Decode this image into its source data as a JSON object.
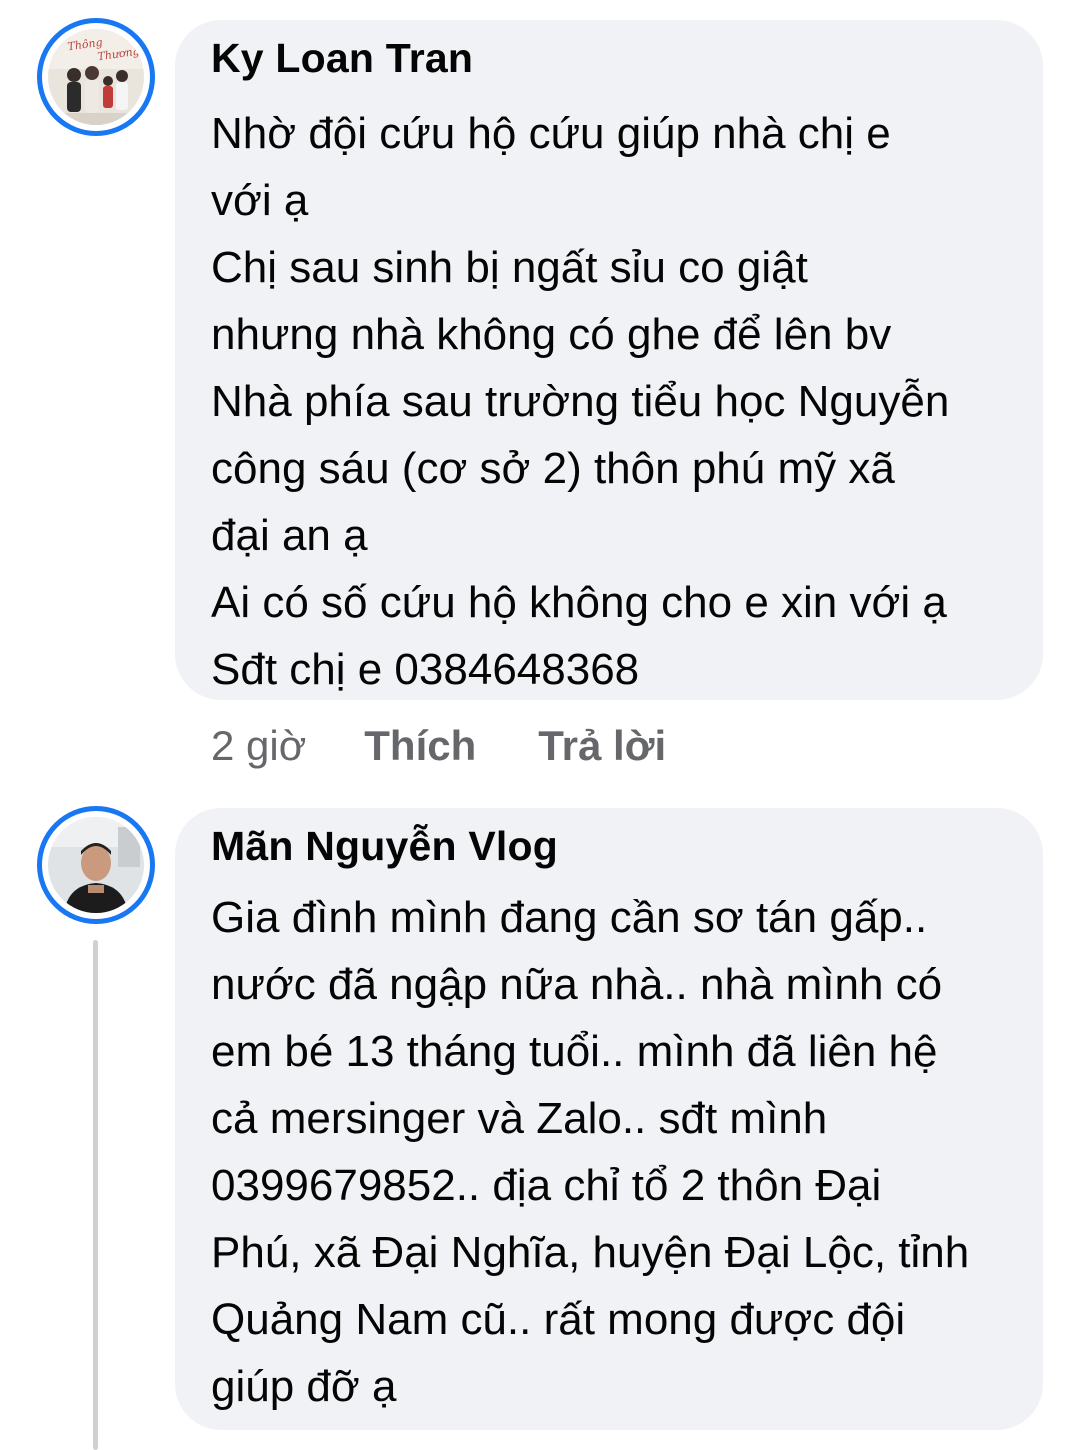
{
  "comments": [
    {
      "author": "Ky Loan Tran",
      "text": "Nhờ đội cứu hộ cứu giúp nhà chị e\nvới ạ\nChị sau sinh bị ngất sỉu co giật\nnhưng nhà không có ghe để lên bv\nNhà phía sau trường tiểu học Nguyễn\ncông sáu (cơ sở 2) thôn phú mỹ xã\nđại an ạ\nAi có số cứu hộ không cho e xin với ạ\nSđt chị e 0384648368",
      "time": "2 giờ",
      "like_label": "Thích",
      "reply_label": "Trả lời",
      "avatar_caption": "Thông Thương"
    },
    {
      "author": "Mãn Nguyễn Vlog",
      "text": "Gia đình mình đang cần sơ tán gấp..\nnước đã ngập nữa nhà.. nhà mình có\nem bé 13 tháng tuổi.. mình đã liên hệ\ncả mersinger và Zalo.. sđt mình\n0399679852.. địa chỉ tổ 2 thôn Đại\nPhú, xã Đại Nghĩa, huyện Đại Lộc, tỉnh\nQuảng Nam cũ.. rất mong được đội\ngiúp đỡ ạ"
    }
  ],
  "colors": {
    "accent": "#1877f2",
    "bubble": "#f0f2f5",
    "meta_text": "#65676b"
  }
}
